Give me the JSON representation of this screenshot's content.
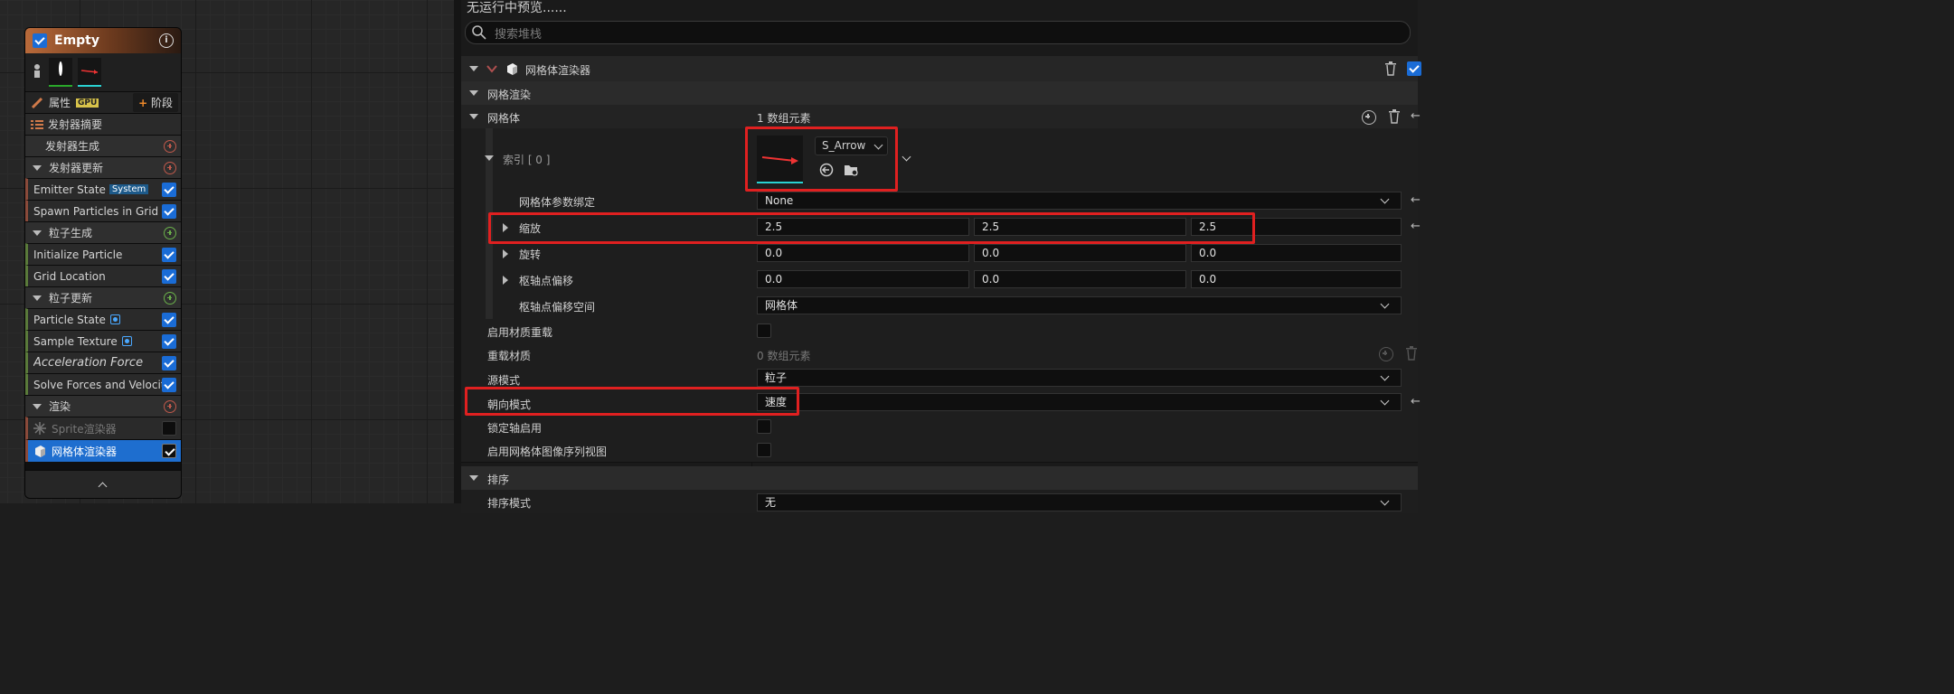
{
  "node": {
    "title": "Empty",
    "properties_label": "属性",
    "gpu_badge": "GPU",
    "stage_button": "阶段",
    "summary_label": "发射器摘要",
    "sections": [
      {
        "label": "发射器生成",
        "color": "#c0594b",
        "collapsible": false
      },
      {
        "label": "发射器更新",
        "color": "#c0594b",
        "collapsible": true
      },
      {
        "label": "粒子生成",
        "color": "#6ab04a",
        "collapsible": true
      },
      {
        "label": "粒子更新",
        "color": "#6ab04a",
        "collapsible": true
      },
      {
        "label": "渲染",
        "color": "#c0594b",
        "collapsible": true
      }
    ],
    "emitter_update_modules": [
      {
        "label": "Emitter State",
        "badge": "System"
      },
      {
        "label": "Spawn Particles in Grid"
      }
    ],
    "particle_spawn_modules": [
      {
        "label": "Initialize Particle"
      },
      {
        "label": "Grid Location"
      }
    ],
    "particle_update_modules": [
      {
        "label": "Particle State"
      },
      {
        "label": "Sample Texture"
      },
      {
        "label": "Acceleration Force"
      },
      {
        "label": "Solve Forces and Velocity"
      }
    ],
    "render_modules": [
      {
        "label": "Sprite渲染器",
        "enabled": false
      },
      {
        "label": "网格体渲染器",
        "enabled": true,
        "selected": true
      }
    ]
  },
  "details": {
    "preview_text": "无运行中预览......",
    "search_placeholder": "搜索堆栈",
    "renderer_header": "网格体渲染器",
    "mesh_render_category": "网格渲染",
    "meshes_label": "网格体",
    "meshes_count": "1 数组元素",
    "index_label": "索引 [ 0 ]",
    "mesh_asset": "S_Arrow",
    "mesh_param_binding_label": "网格体参数绑定",
    "mesh_param_binding_value": "None",
    "scale_label": "缩放",
    "scale": [
      "2.5",
      "2.5",
      "2.5"
    ],
    "rotation_label": "旋转",
    "rotation": [
      "0.0",
      "0.0",
      "0.0"
    ],
    "pivot_offset_label": "枢轴点偏移",
    "pivot_offset": [
      "0.0",
      "0.0",
      "0.0"
    ],
    "pivot_space_label": "枢轴点偏移空间",
    "pivot_space_value": "网格体",
    "enable_material_override_label": "启用材质重载",
    "override_materials_label": "重载材质",
    "override_materials_count": "0 数组元素",
    "source_mode_label": "源模式",
    "source_mode_value": "粒子",
    "facing_mode_label": "朝向模式",
    "facing_mode_value": "速度",
    "locked_axis_label": "锁定轴启用",
    "flipbook_label": "启用网格体图像序列视图",
    "sorting_category": "排序",
    "sort_mode_label": "排序模式",
    "sort_mode_value": "无"
  },
  "colors": {
    "accent_blue": "#1e6ecf",
    "highlight_red": "#e02020",
    "title_orange": "#b96a3a"
  }
}
